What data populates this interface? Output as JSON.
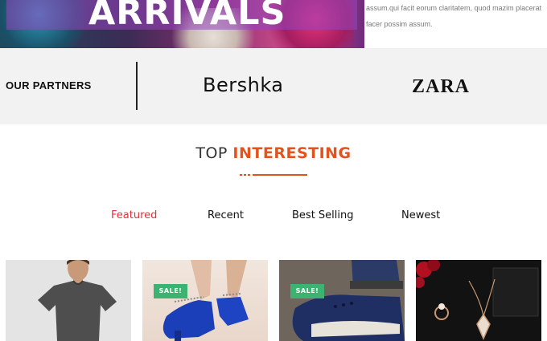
{
  "hero": {
    "title": "ARRIVALS",
    "text": "assum.qui facit eorum claritatem, quod mazim placerat facer possim assum."
  },
  "partners": {
    "label": "OUR PARTNERS",
    "logos": [
      "Bershka",
      "ZARA"
    ]
  },
  "section": {
    "title_plain": "TOP",
    "title_accent": "INTERESTING"
  },
  "tabs": [
    "Featured",
    "Recent",
    "Best Selling",
    "Newest"
  ],
  "active_tab": "Featured",
  "products": [
    {
      "category": "men-tshirt",
      "badge": ""
    },
    {
      "category": "women-heels",
      "badge": "SALE!"
    },
    {
      "category": "shoes",
      "badge": "SALE!"
    },
    {
      "category": "jewelry",
      "badge": ""
    }
  ],
  "colors": {
    "accent_orange": "#e2541f",
    "active_tab_red": "#e8303c",
    "sale_badge_green": "#3cb371",
    "partners_bg": "#f2f2f2"
  }
}
